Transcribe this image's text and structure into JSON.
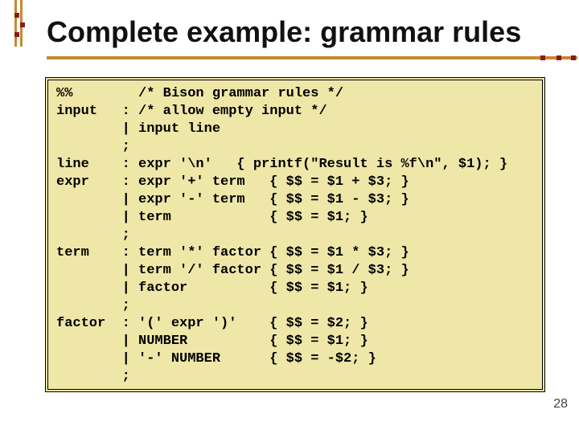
{
  "title": "Complete example: grammar rules",
  "code": "%%        /* Bison grammar rules */\ninput   : /* allow empty input */\n        | input line\n        ;\nline    : expr '\\n'   { printf(\"Result is %f\\n\", $1); }\nexpr    : expr '+' term   { $$ = $1 + $3; }\n        | expr '-' term   { $$ = $1 - $3; }\n        | term            { $$ = $1; }\n        ;\nterm    : term '*' factor { $$ = $1 * $3; }\n        | term '/' factor { $$ = $1 / $3; }\n        | factor          { $$ = $1; }\n        ;\nfactor  : '(' expr ')'    { $$ = $2; }\n        | NUMBER          { $$ = $1; }\n        | '-' NUMBER      { $$ = -$2; }\n        ;",
  "page": "28"
}
